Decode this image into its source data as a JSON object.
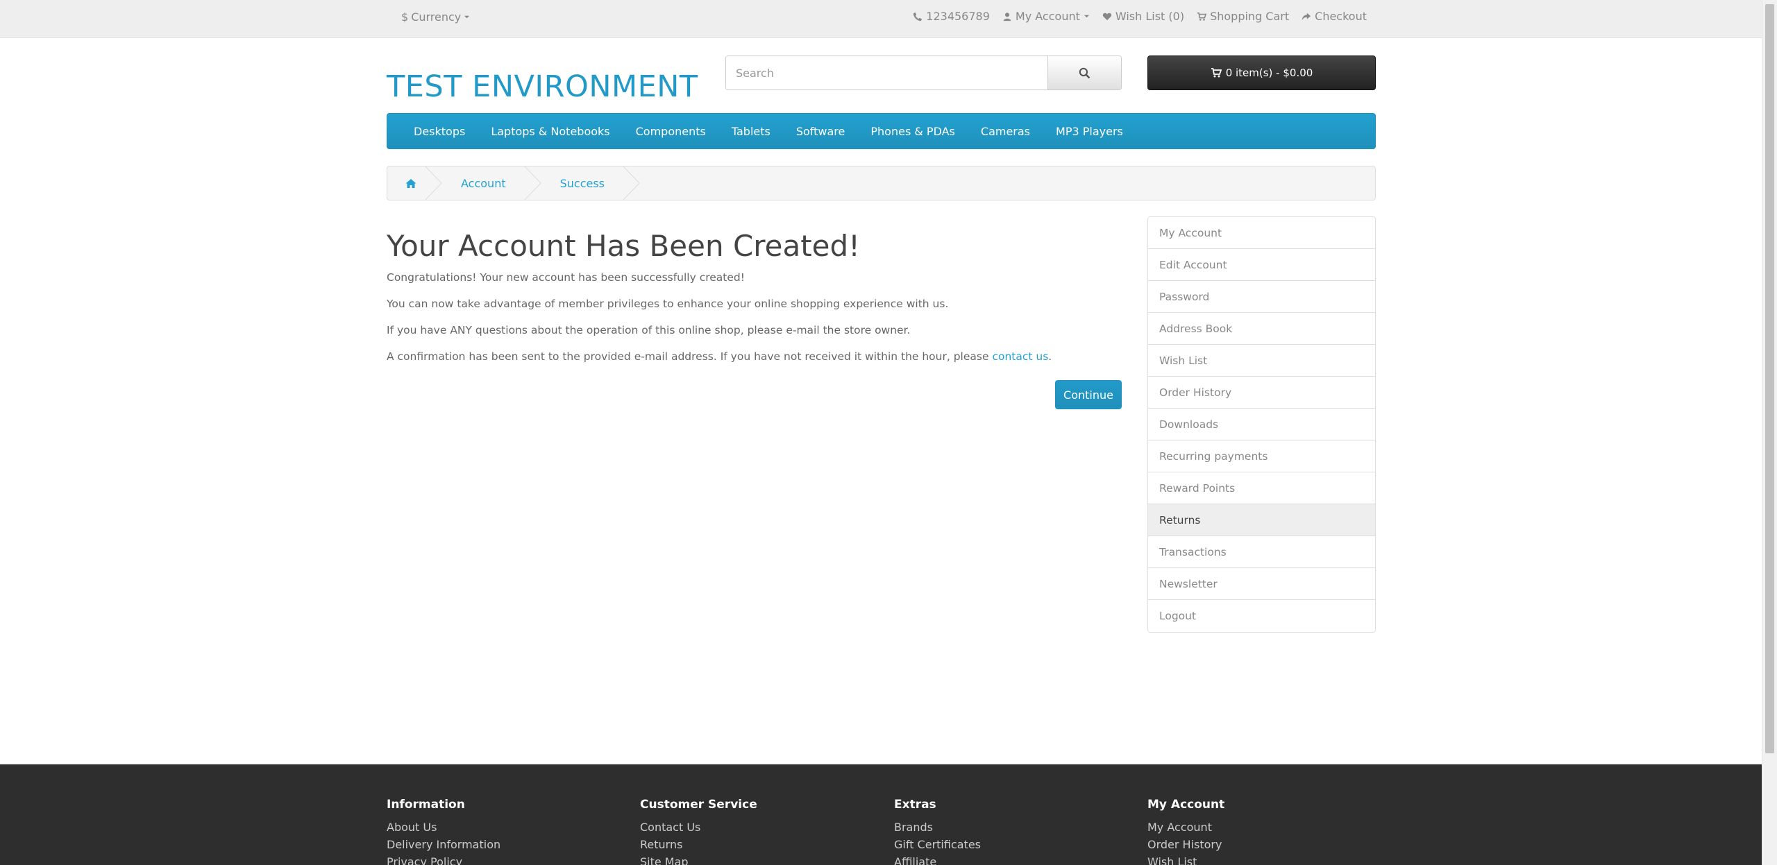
{
  "top": {
    "currency": "Currency",
    "phone": "123456789",
    "my_account": "My Account",
    "wish_list": "Wish List (0)",
    "shopping_cart": "Shopping Cart",
    "checkout": "Checkout"
  },
  "header": {
    "logo": "TEST ENVIRONMENT",
    "search_placeholder": "Search",
    "cart": "0 item(s) - $0.00"
  },
  "menu": [
    "Desktops",
    "Laptops & Notebooks",
    "Components",
    "Tablets",
    "Software",
    "Phones & PDAs",
    "Cameras",
    "MP3 Players"
  ],
  "breadcrumb": [
    "Account",
    "Success"
  ],
  "content": {
    "title": "Your Account Has Been Created!",
    "p1": "Congratulations! Your new account has been successfully created!",
    "p2": "You can now take advantage of member privileges to enhance your online shopping experience with us.",
    "p3": "If you have ANY questions about the operation of this online shop, please e-mail the store owner.",
    "p4_prefix": "A confirmation has been sent to the provided e-mail address. If you have not received it within the hour, please ",
    "p4_link": "contact us",
    "p4_suffix": ".",
    "continue": "Continue"
  },
  "sidebar": [
    "My Account",
    "Edit Account",
    "Password",
    "Address Book",
    "Wish List",
    "Order History",
    "Downloads",
    "Recurring payments",
    "Reward Points",
    "Returns",
    "Transactions",
    "Newsletter",
    "Logout"
  ],
  "footer": {
    "cols": [
      {
        "title": "Information",
        "links": [
          "About Us",
          "Delivery Information",
          "Privacy Policy"
        ]
      },
      {
        "title": "Customer Service",
        "links": [
          "Contact Us",
          "Returns",
          "Site Map"
        ]
      },
      {
        "title": "Extras",
        "links": [
          "Brands",
          "Gift Certificates",
          "Affiliate"
        ]
      },
      {
        "title": "My Account",
        "links": [
          "My Account",
          "Order History",
          "Wish List"
        ]
      }
    ]
  },
  "colors": {
    "brand": "#229ac8",
    "dark": "#2e2e2e"
  }
}
